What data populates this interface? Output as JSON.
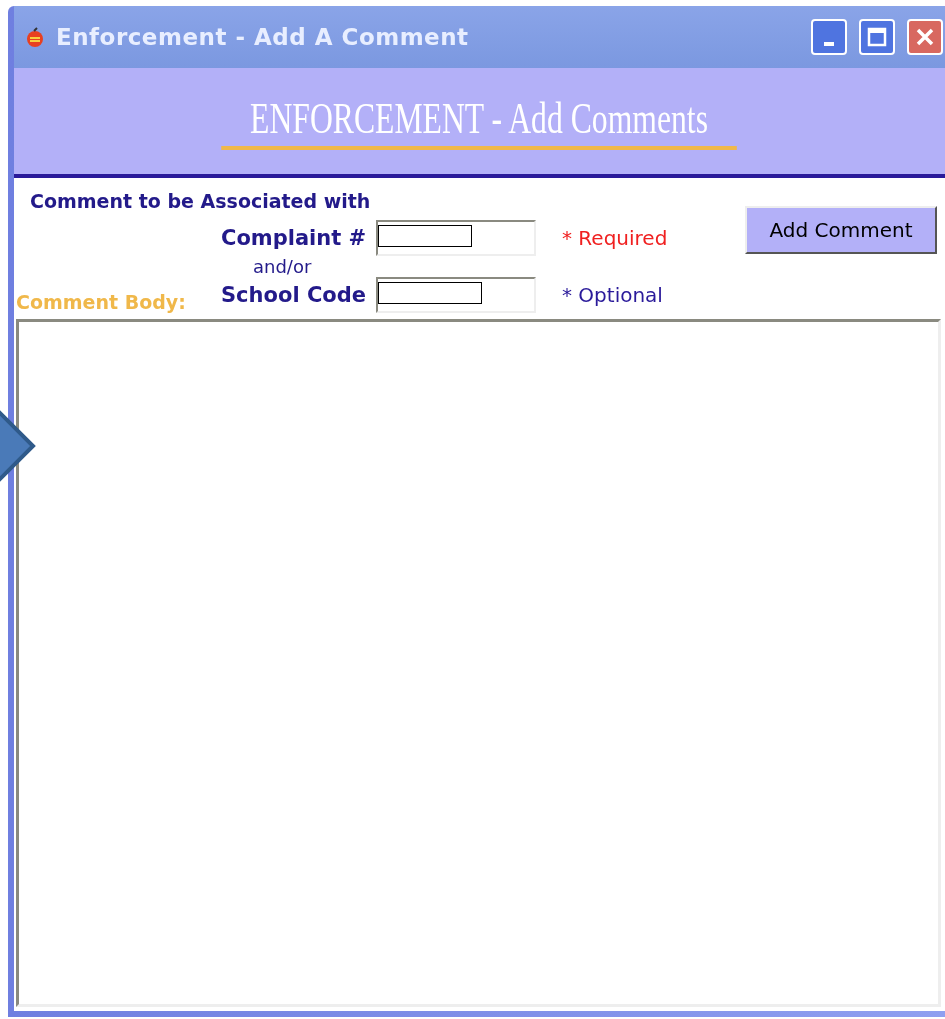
{
  "window": {
    "title": "Enforcement - Add A Comment"
  },
  "banner": {
    "title": "ENFORCEMENT - Add Comments"
  },
  "form": {
    "heading": "Comment to be Associated with",
    "fields": [
      {
        "label": "Complaint #",
        "note": "* Required",
        "kind": "required"
      },
      {
        "label": "School Code",
        "note": "* Optional",
        "kind": "optional"
      }
    ],
    "connector": "and/or",
    "button": "Add Comment",
    "body_label": "Comment Body:"
  }
}
